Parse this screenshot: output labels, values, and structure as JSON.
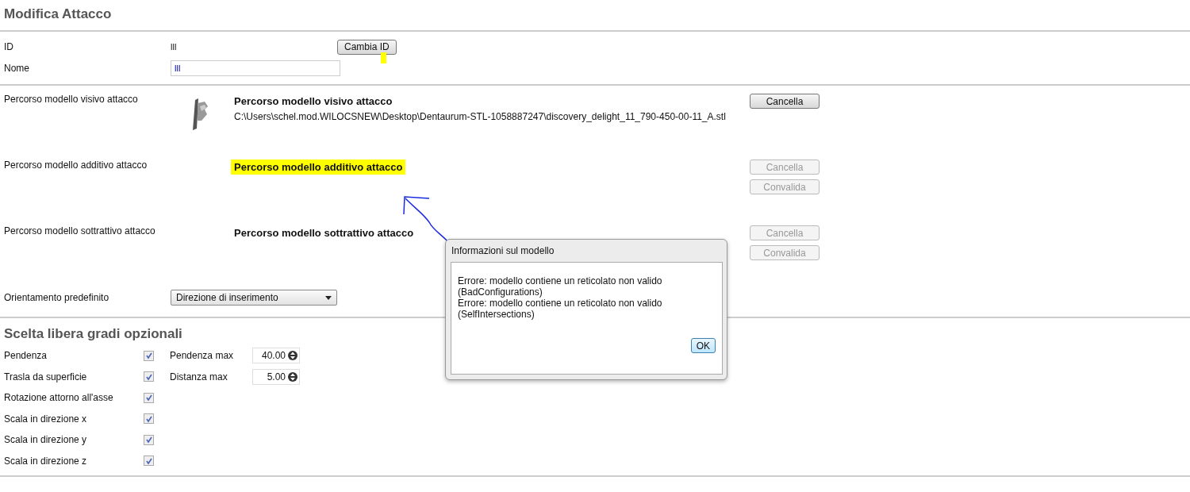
{
  "title": "Modifica Attacco",
  "id_row": {
    "label": "ID",
    "value": "lll",
    "button": "Cambia ID"
  },
  "name_row": {
    "label": "Nome",
    "value": "lll"
  },
  "models": [
    {
      "label": "Percorso modello visivo attacco",
      "title": "Percorso modello visivo attacco",
      "highlighted": false,
      "thumbnail": true,
      "path": "C:\\Users\\schel.mod.WILOCSNEW\\Desktop\\Dentaurum-STL-1058887247\\discovery_delight_11_790-450-00-11_A.stl",
      "buttons": [
        {
          "label": "Cancella",
          "disabled": false
        }
      ]
    },
    {
      "label": "Percorso modello additivo attacco",
      "title": "Percorso modello additivo attacco",
      "highlighted": true,
      "thumbnail": false,
      "buttons": [
        {
          "label": "Cancella",
          "disabled": true
        },
        {
          "label": "Convalida",
          "disabled": true
        }
      ]
    },
    {
      "label": "Percorso modello sottrattivo attacco",
      "title": "Percorso modello sottrattivo attacco",
      "highlighted": false,
      "thumbnail": false,
      "buttons": [
        {
          "label": "Cancella",
          "disabled": true
        },
        {
          "label": "Convalida",
          "disabled": true
        }
      ]
    }
  ],
  "orientation": {
    "label": "Orientamento predefinito",
    "value": "Direzione di inserimento"
  },
  "section_title": "Scelta libera gradi opzionali",
  "options": [
    {
      "label": "Pendenza",
      "checked": true,
      "param": {
        "label": "Pendenza max",
        "value": "40.00"
      }
    },
    {
      "label": "Trasla da superficie",
      "checked": true,
      "param": {
        "label": "Distanza max",
        "value": "5.00"
      }
    },
    {
      "label": "Rotazione attorno all'asse",
      "checked": true
    },
    {
      "label": "Scala in direzione x",
      "checked": true
    },
    {
      "label": "Scala in direzione y",
      "checked": true
    },
    {
      "label": "Scala in direzione z",
      "checked": true
    }
  ],
  "dialog": {
    "title": "Informazioni sul modello",
    "lines": [
      "Errore: modello contiene un reticolato non valido",
      "(BadConfigurations)",
      "Errore: modello contiene un reticolato non valido",
      "(SelfIntersections)"
    ],
    "button": "OK"
  }
}
